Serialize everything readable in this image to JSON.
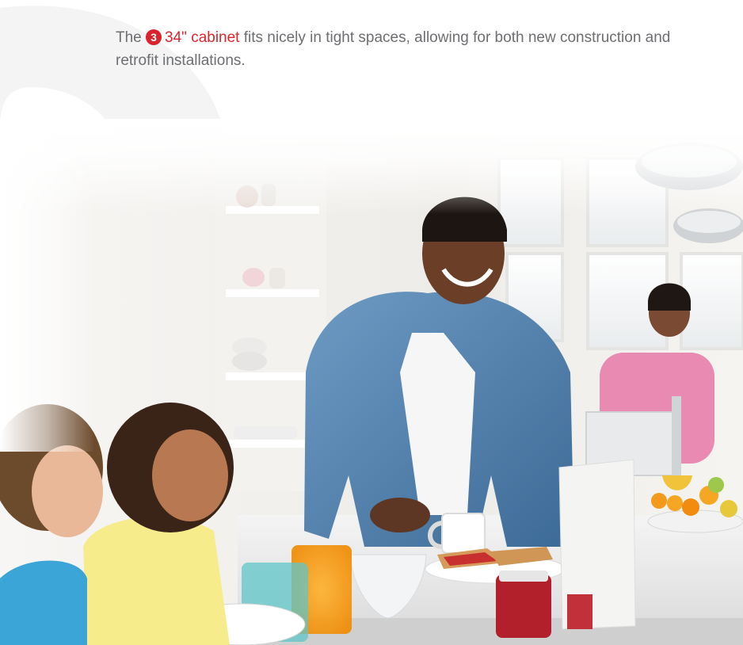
{
  "intro": {
    "prefix": "The ",
    "step_number": "3",
    "highlight": "34\" cabinet",
    "suffix": " fits nicely in tight spaces, allowing for both new construction and retrofit installations."
  },
  "colors": {
    "accent": "#d9242d",
    "body_text": "#6d6e71",
    "watermark": "#f3f3f3"
  },
  "photo": {
    "subject": "family-breakfast-in-kitchen"
  }
}
